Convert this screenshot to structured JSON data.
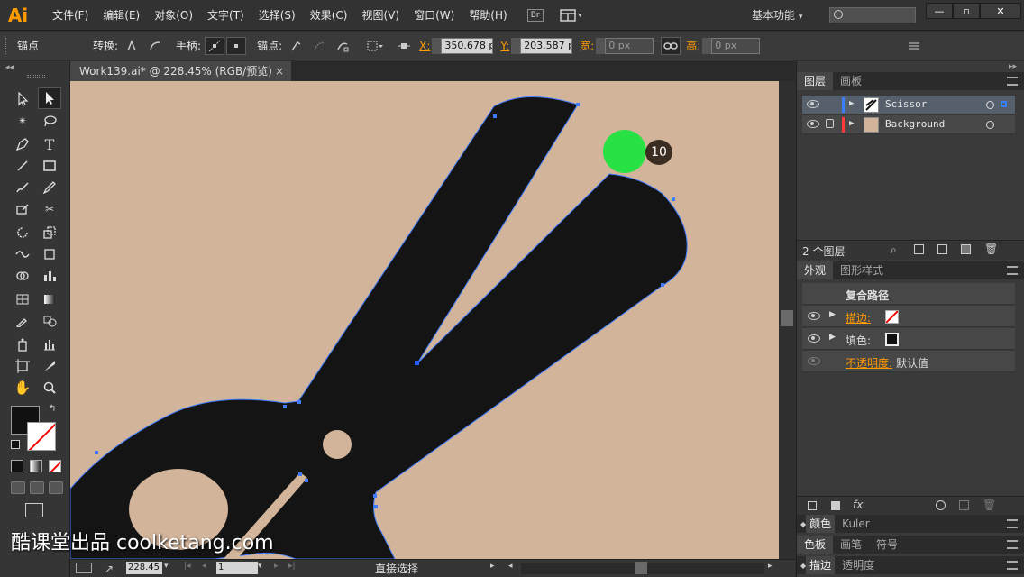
{
  "app": {
    "logo": "Ai",
    "workspace": "基本功能",
    "brand_color": "#ff9a00"
  },
  "menus": [
    "文件(F)",
    "编辑(E)",
    "对象(O)",
    "文字(T)",
    "选择(S)",
    "效果(C)",
    "视图(V)",
    "窗口(W)",
    "帮助(H)"
  ],
  "menu_extra": {
    "bridge": "Br"
  },
  "control_bar": {
    "title": "锚点",
    "convert_label": "转换:",
    "handle_label": "手柄:",
    "anchor_label": "锚点:",
    "x_label": "X:",
    "x_value": "350.678 p",
    "y_label": "Y:",
    "y_value": "203.587 p",
    "width_label": "宽:",
    "width_value": "0 px",
    "height_label": "高:",
    "height_value": "0 px"
  },
  "document": {
    "tab_title": "Work139.ai* @ 228.45% (RGB/预览)",
    "close_symbol": "×",
    "canvas_color": "#d2b49a",
    "shape_color": "#141414"
  },
  "status_bar": {
    "zoom": "228.45",
    "page": "1",
    "tool": "直接选择"
  },
  "layers_panel": {
    "tabs": [
      "图层",
      "画板"
    ],
    "layers": [
      {
        "name": "Scissor",
        "color": "#3a7fff"
      },
      {
        "name": "Background",
        "color": "#ff3a3a"
      }
    ],
    "count_text": "2 个图层"
  },
  "appearance_panel": {
    "tabs": [
      "外观",
      "图形样式"
    ],
    "header": "复合路径",
    "stroke_label": "描边:",
    "fill_label": "填色:",
    "opacity_label": "不透明度:",
    "opacity_value": "默认值",
    "fx_label": "fx"
  },
  "collapsed_panels": [
    {
      "tabs": [
        "颜色",
        "Kuler"
      ]
    },
    {
      "tabs": [
        "色板",
        "画笔",
        "符号"
      ]
    },
    {
      "tabs": [
        "描边",
        "透明度"
      ]
    }
  ],
  "overlay": {
    "click_count": "10"
  },
  "watermark": "酷课堂出品 coolketang.com"
}
